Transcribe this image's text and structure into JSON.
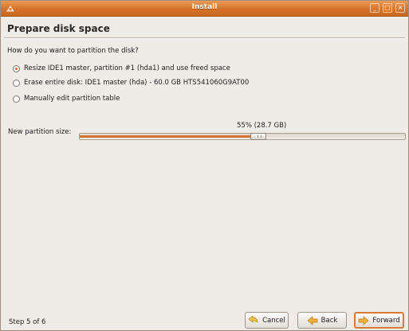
{
  "window": {
    "title": "Install"
  },
  "page": {
    "title": "Prepare disk space",
    "question": "How do you want to partition the disk?"
  },
  "options": [
    {
      "label": "Resize IDE1 master, partition #1 (hda1) and use freed space",
      "selected": true
    },
    {
      "label": "Erase entire disk: IDE1 master (hda) - 60.0 GB HTS541060G9AT00",
      "selected": false
    },
    {
      "label": "Manually edit partition table",
      "selected": false
    }
  ],
  "partition_slider": {
    "label": "New partition size:",
    "value_text": "55% (28.7 GB)",
    "fraction": 0.55
  },
  "footer": {
    "step_text": "Step 5 of 6",
    "cancel_label": "Cancel",
    "back_label": "Back",
    "forward_label": "Forward"
  },
  "colors": {
    "accent": "#d8692a",
    "titlebar": "#d7742a"
  }
}
